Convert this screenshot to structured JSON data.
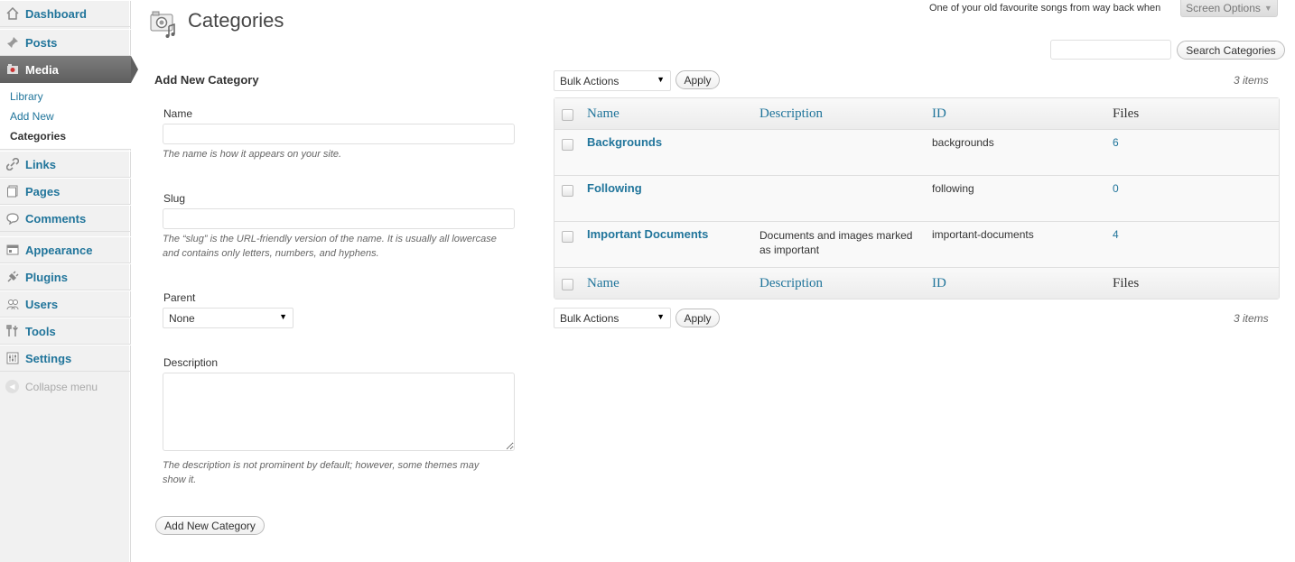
{
  "sidebar": {
    "items": [
      {
        "label": "Dashboard",
        "icon": "dashboard-icon"
      },
      {
        "label": "Posts",
        "icon": "pushpin-icon"
      },
      {
        "label": "Media",
        "icon": "media-icon",
        "current": true
      },
      {
        "label": "Links",
        "icon": "link-icon"
      },
      {
        "label": "Pages",
        "icon": "pages-icon"
      },
      {
        "label": "Comments",
        "icon": "comment-icon"
      },
      {
        "label": "Appearance",
        "icon": "appearance-icon"
      },
      {
        "label": "Plugins",
        "icon": "plugin-icon"
      },
      {
        "label": "Users",
        "icon": "users-icon"
      },
      {
        "label": "Tools",
        "icon": "tools-icon"
      },
      {
        "label": "Settings",
        "icon": "settings-icon"
      }
    ],
    "submenu": [
      {
        "label": "Library"
      },
      {
        "label": "Add New"
      },
      {
        "label": "Categories",
        "current": true
      }
    ],
    "collapse_label": "Collapse menu"
  },
  "header": {
    "title": "Categories",
    "song": "One of your old favourite songs from way back when",
    "screen_options": "Screen Options",
    "search_button": "Search Categories",
    "search_value": ""
  },
  "form": {
    "heading": "Add New Category",
    "name_label": "Name",
    "name_value": "",
    "name_help": "The name is how it appears on your site.",
    "slug_label": "Slug",
    "slug_value": "",
    "slug_help_line1": "The “slug” is the URL-friendly version of the name. It is usually all lowercase",
    "slug_help_line2": "and contains only letters, numbers, and hyphens.",
    "parent_label": "Parent",
    "parent_selected": "None",
    "description_label": "Description",
    "description_value": "",
    "description_help_line1": "The description is not prominent by default; however, some themes may",
    "description_help_line2": "show it.",
    "submit_label": "Add New Category"
  },
  "list": {
    "bulk_actions": "Bulk Actions",
    "apply": "Apply",
    "items_count": "3 items",
    "columns": {
      "name": "Name",
      "description": "Description",
      "id": "ID",
      "files": "Files"
    },
    "rows": [
      {
        "name": "Backgrounds",
        "description_line1": "",
        "description_line2": "",
        "id": "backgrounds",
        "files": "6"
      },
      {
        "name": "Following",
        "description_line1": "",
        "description_line2": "",
        "id": "following",
        "files": "0"
      },
      {
        "name": "Important Documents",
        "description_line1": "Documents and images marked",
        "description_line2": "as important",
        "id": "important-documents",
        "files": "4"
      }
    ]
  },
  "colors": {
    "link": "#21759b",
    "menu_current": "#6d6d6d"
  }
}
